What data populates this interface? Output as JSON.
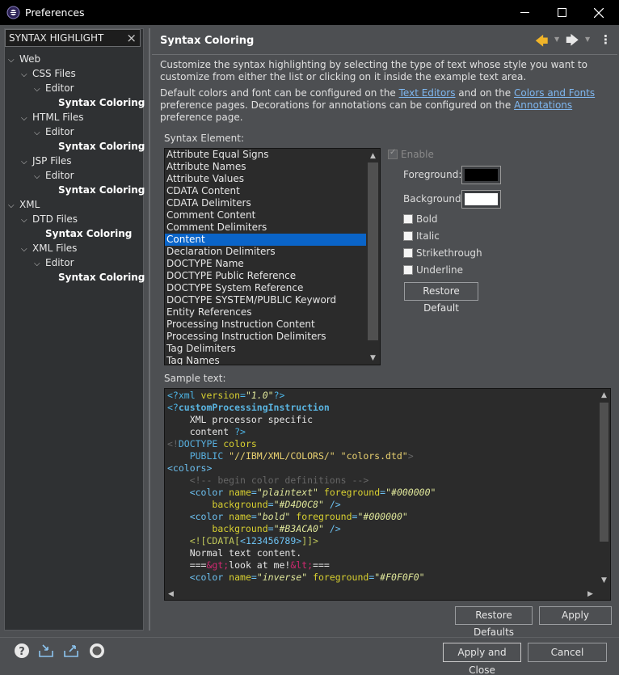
{
  "window": {
    "title": "Preferences",
    "icon": "eclipse-icon"
  },
  "filter": {
    "value": "SYNTAX HIGHLIGHT",
    "clear_icon": "clear-icon"
  },
  "tree": [
    {
      "label": "Web",
      "depth": 0,
      "expanded": true,
      "selected": false
    },
    {
      "label": "CSS Files",
      "depth": 1,
      "expanded": true,
      "selected": false
    },
    {
      "label": "Editor",
      "depth": 2,
      "expanded": true,
      "selected": false
    },
    {
      "label": "Syntax Coloring",
      "depth": 3,
      "expanded": null,
      "selected": true
    },
    {
      "label": "HTML Files",
      "depth": 1,
      "expanded": true,
      "selected": false
    },
    {
      "label": "Editor",
      "depth": 2,
      "expanded": true,
      "selected": false
    },
    {
      "label": "Syntax Coloring",
      "depth": 3,
      "expanded": null,
      "selected": true
    },
    {
      "label": "JSP Files",
      "depth": 1,
      "expanded": true,
      "selected": false
    },
    {
      "label": "Editor",
      "depth": 2,
      "expanded": true,
      "selected": false
    },
    {
      "label": "Syntax Coloring",
      "depth": 3,
      "expanded": null,
      "selected": true
    },
    {
      "label": "XML",
      "depth": 0,
      "expanded": true,
      "selected": false
    },
    {
      "label": "DTD Files",
      "depth": 1,
      "expanded": true,
      "selected": false
    },
    {
      "label": "Syntax Coloring",
      "depth": 2,
      "expanded": null,
      "selected": true
    },
    {
      "label": "XML Files",
      "depth": 1,
      "expanded": true,
      "selected": false
    },
    {
      "label": "Editor",
      "depth": 2,
      "expanded": true,
      "selected": false
    },
    {
      "label": "Syntax Coloring",
      "depth": 3,
      "expanded": null,
      "selected": true
    }
  ],
  "page": {
    "title": "Syntax Coloring",
    "description": "Customize the syntax highlighting by selecting the type of text whose style you want to customize from either the list or clicking on it inside the example text area.",
    "defaults_1": "Default colors and font can be configured on the ",
    "link_text_editors": "Text Editors",
    "defaults_2": " and on the ",
    "link_colors_fonts": "Colors and Fonts",
    "defaults_3": " preference pages.  Decorations for annotations can be configured on the ",
    "link_annotations": "Annotations",
    "defaults_4": " preference page."
  },
  "syntax": {
    "label": "Syntax Element:",
    "items": [
      "Attribute Equal Signs",
      "Attribute Names",
      "Attribute Values",
      "CDATA Content",
      "CDATA Delimiters",
      "Comment Content",
      "Comment Delimiters",
      "Content",
      "Declaration Delimiters",
      "DOCTYPE Name",
      "DOCTYPE Public Reference",
      "DOCTYPE System Reference",
      "DOCTYPE SYSTEM/PUBLIC Keyword",
      "Entity References",
      "Processing Instruction Content",
      "Processing Instruction Delimiters",
      "Tag Delimiters",
      "Tag Names"
    ],
    "selected_index": 7
  },
  "style": {
    "enable_label": "Enable",
    "foreground_label": "Foreground:",
    "foreground_color": "#000000",
    "background_label": "Background:",
    "background_color": "#ffffff",
    "bold_label": "Bold",
    "italic_label": "Italic",
    "strike_label": "Strikethrough",
    "underline_label": "Underline",
    "restore_default_label": "Restore Default"
  },
  "sample": {
    "label": "Sample text:"
  },
  "buttons": {
    "restore_defaults": "Restore Defaults",
    "apply": "Apply",
    "apply_close": "Apply and Close",
    "cancel": "Cancel"
  },
  "colors": {
    "selection": "#0a64c8",
    "link": "#7fb7f0"
  }
}
